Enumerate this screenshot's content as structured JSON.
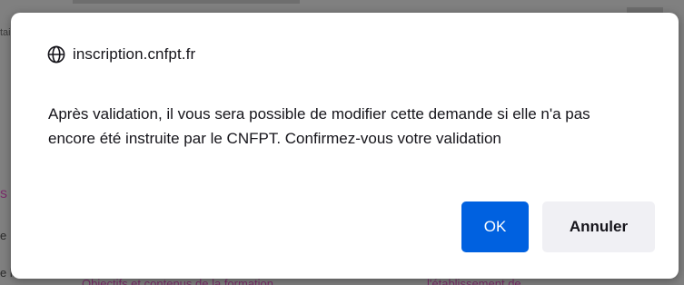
{
  "dialog": {
    "origin": "inscription.cnfpt.fr",
    "origin_icon": "globe-icon",
    "message": "Après validation, il vous sera possible de modifier cette demande si elle n'a pas encore été instruite par le CNFPT. Confirmez-vous votre validation",
    "ok_label": "OK",
    "cancel_label": "Annuler"
  },
  "background": {
    "fragment_1": "tai",
    "fragment_2": "s",
    "fragment_3": "e",
    "fragment_4": "e la",
    "fragment_5": "Objectifs et contenus de la formation",
    "fragment_6": "l'établissement de"
  },
  "colors": {
    "primary_button": "#0061e0",
    "secondary_button": "#f0f0f4",
    "backdrop": "#808080"
  }
}
